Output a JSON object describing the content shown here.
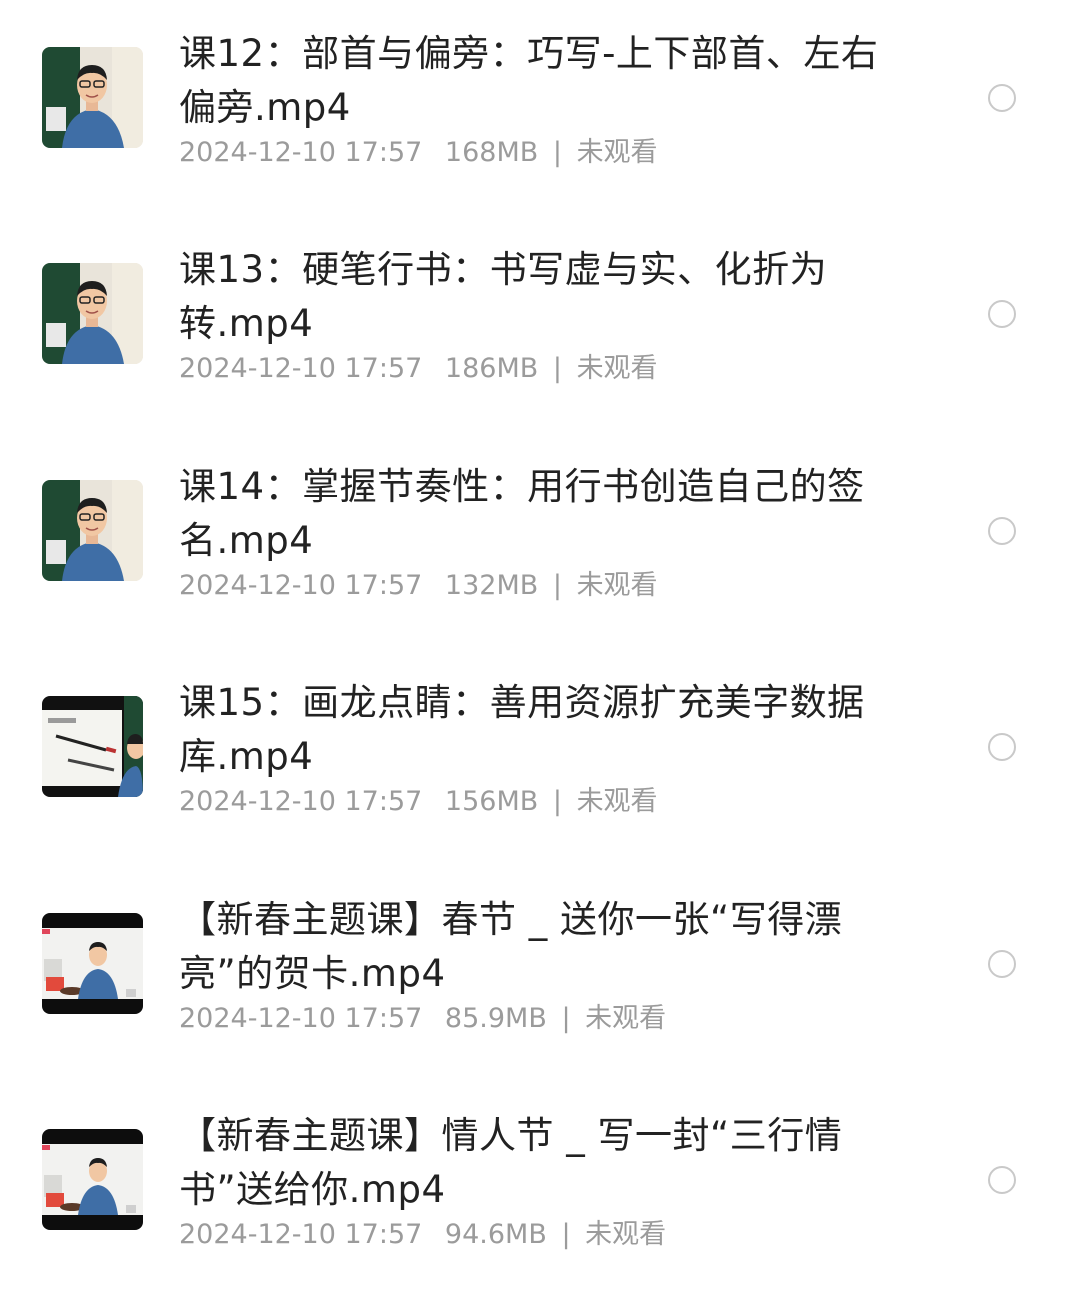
{
  "files": [
    {
      "title": "课12：部首与偏旁：巧写-上下部首、左右偏旁.mp4",
      "date": "2024-12-10 17:57",
      "size": "168MB",
      "status": "未观看",
      "thumb_style": "classroom"
    },
    {
      "title": "课13：硬笔行书：书写虚与实、化折为转.mp4",
      "date": "2024-12-10 17:57",
      "size": "186MB",
      "status": "未观看",
      "thumb_style": "classroom"
    },
    {
      "title": "课14：掌握节奏性：用行书创造自己的签名.mp4",
      "date": "2024-12-10 17:57",
      "size": "132MB",
      "status": "未观看",
      "thumb_style": "classroom"
    },
    {
      "title": "课15：画龙点睛：善用资源扩充美字数据库.mp4",
      "date": "2024-12-10 17:57",
      "size": "156MB",
      "status": "未观看",
      "thumb_style": "slides"
    },
    {
      "title": "【新春主题课】春节 _ 送你一张“写得漂亮”的贺卡.mp4",
      "date": "2024-12-10 17:57",
      "size": "85.9MB",
      "status": "未观看",
      "thumb_style": "studio"
    },
    {
      "title": "【新春主题课】情人节 _ 写一封“三行情书”送给你.mp4",
      "date": "2024-12-10 17:57",
      "size": "94.6MB",
      "status": "未观看",
      "thumb_style": "studio"
    }
  ],
  "separator": "|",
  "colors": {
    "title": "#222222",
    "meta": "#9b9b9b",
    "radio_border": "#c9c9c9",
    "shirt": "#3f6ea6"
  }
}
